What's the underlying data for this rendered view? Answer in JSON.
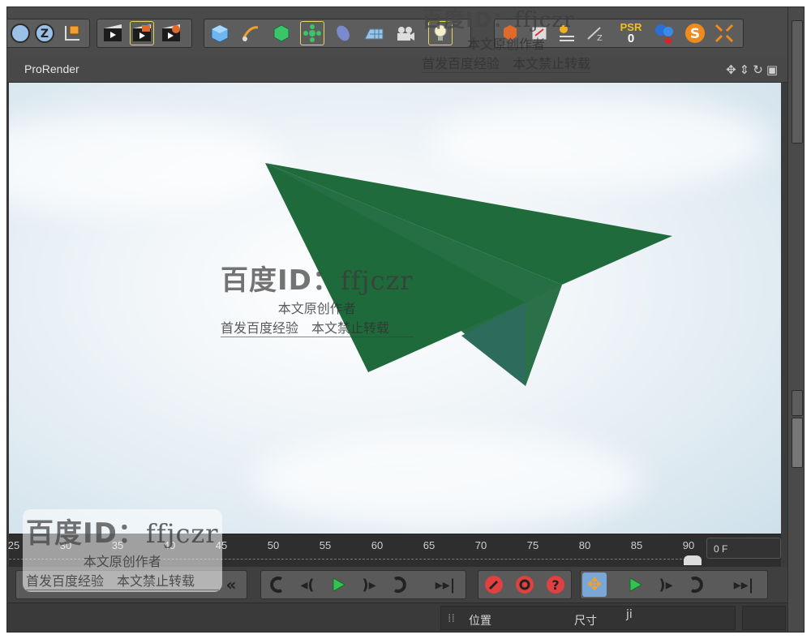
{
  "viewport": {
    "title": "ProRender",
    "header_icons": [
      "move-icon",
      "scale-icon",
      "rotate-icon",
      "layout-icon"
    ]
  },
  "toolbar": {
    "psr_label": "PSR",
    "psr_value": "0"
  },
  "timeline": {
    "ticks": [
      "25",
      "30",
      "35",
      "40",
      "45",
      "50",
      "55",
      "60",
      "65",
      "70",
      "75",
      "80",
      "85",
      "90"
    ],
    "current_frame": "0 F"
  },
  "status": {
    "position_label": "位置",
    "size_label": "尺寸",
    "extra": "ji"
  },
  "watermark": {
    "id_zh": "百度ID：",
    "id_en": "ffjczr",
    "line2": "本文原创作者",
    "line3": "首发百度经验　本文禁止转载"
  },
  "colors": {
    "plane_dark": "#1f6b3c",
    "plane_mid": "#256f45",
    "plane_shadow": "#2e6b5c",
    "accent_blue": "#4d8fd6"
  }
}
